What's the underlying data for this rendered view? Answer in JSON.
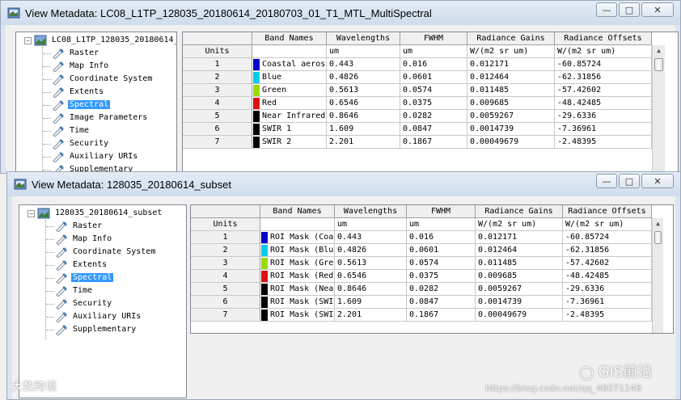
{
  "colors": {
    "band1": "#0000cc",
    "band2": "#00ccee",
    "band3": "#99dd00",
    "band4": "#dd1111",
    "band5": "#000000",
    "band6": "#000000",
    "band7": "#000000",
    "selection": "#3399ff"
  },
  "window1": {
    "title": "View Metadata: LC08_L1TP_128035_20180614_20180703_01_T1_MTL_MultiSpectral",
    "tree": {
      "root": "LC08_L1TP_128035_20180614_",
      "items": [
        "Raster",
        "Map Info",
        "Coordinate System",
        "Extents",
        "Spectral",
        "Image Parameters",
        "Time",
        "Security",
        "Auxiliary URIs",
        "Supplementary"
      ],
      "selected": "Spectral"
    },
    "table": {
      "headers": [
        "Band Names",
        "Wavelengths",
        "FWHM",
        "Radiance Gains",
        "Radiance Offsets"
      ],
      "units_label": "Units",
      "units": [
        "",
        "um",
        "um",
        "W/(m2 sr um)",
        "W/(m2 sr um)"
      ],
      "rows": [
        {
          "num": "1",
          "name": "Coastal aeroso",
          "wl": "0.443",
          "fwhm": "0.016",
          "gain": "0.012171",
          "offset": "-60.85724"
        },
        {
          "num": "2",
          "name": "Blue",
          "wl": "0.4826",
          "fwhm": "0.0601",
          "gain": "0.012464",
          "offset": "-62.31856"
        },
        {
          "num": "3",
          "name": "Green",
          "wl": "0.5613",
          "fwhm": "0.0574",
          "gain": "0.011485",
          "offset": "-57.42602"
        },
        {
          "num": "4",
          "name": "Red",
          "wl": "0.6546",
          "fwhm": "0.0375",
          "gain": "0.009685",
          "offset": "-48.42485"
        },
        {
          "num": "5",
          "name": "Near Infrared",
          "wl": "0.8646",
          "fwhm": "0.0282",
          "gain": "0.0059267",
          "offset": "-29.6336"
        },
        {
          "num": "6",
          "name": "SWIR 1",
          "wl": "1.609",
          "fwhm": "0.0847",
          "gain": "0.0014739",
          "offset": "-7.36961"
        },
        {
          "num": "7",
          "name": "SWIR 2",
          "wl": "2.201",
          "fwhm": "0.1867",
          "gain": "0.00049679",
          "offset": "-2.48395"
        }
      ]
    }
  },
  "window2": {
    "title": "View Metadata: 128035_20180614_subset",
    "tree": {
      "root": "128035_20180614_subset",
      "items": [
        "Raster",
        "Map Info",
        "Coordinate System",
        "Extents",
        "Spectral",
        "Time",
        "Security",
        "Auxiliary URIs",
        "Supplementary"
      ],
      "selected": "Spectral"
    },
    "table": {
      "headers": [
        "Band Names",
        "Wavelengths",
        "FWHM",
        "Radiance Gains",
        "Radiance Offsets"
      ],
      "units_label": "Units",
      "units": [
        "",
        "um",
        "um",
        "W/(m2 sr um)",
        "W/(m2 sr um)"
      ],
      "rows": [
        {
          "num": "1",
          "name": "ROI Mask (Coas",
          "wl": "0.443",
          "fwhm": "0.016",
          "gain": "0.012171",
          "offset": "-60.85724"
        },
        {
          "num": "2",
          "name": "ROI Mask (Blue",
          "wl": "0.4826",
          "fwhm": "0.0601",
          "gain": "0.012464",
          "offset": "-62.31856"
        },
        {
          "num": "3",
          "name": "ROI Mask (Gree",
          "wl": "0.5613",
          "fwhm": "0.0574",
          "gain": "0.011485",
          "offset": "-57.42602"
        },
        {
          "num": "4",
          "name": "ROI Mask (Red)",
          "wl": "0.6546",
          "fwhm": "0.0375",
          "gain": "0.009685",
          "offset": "-48.42485"
        },
        {
          "num": "5",
          "name": "ROI Mask (Near",
          "wl": "0.8646",
          "fwhm": "0.0282",
          "gain": "0.0059267",
          "offset": "-29.6336"
        },
        {
          "num": "6",
          "name": "ROI Mask (SWIR",
          "wl": "1.609",
          "fwhm": "0.0847",
          "gain": "0.0014739",
          "offset": "-7.36961"
        },
        {
          "num": "7",
          "name": "ROI Mask (SWIR",
          "wl": "2.201",
          "fwhm": "0.1867",
          "gain": "0.00049679",
          "offset": "-2.48395"
        }
      ]
    }
  },
  "watermarks": {
    "left": "大数跨境",
    "right_brand": "GIS前沿",
    "right_url": "https://blog.csdn.net/qq_46071148"
  }
}
